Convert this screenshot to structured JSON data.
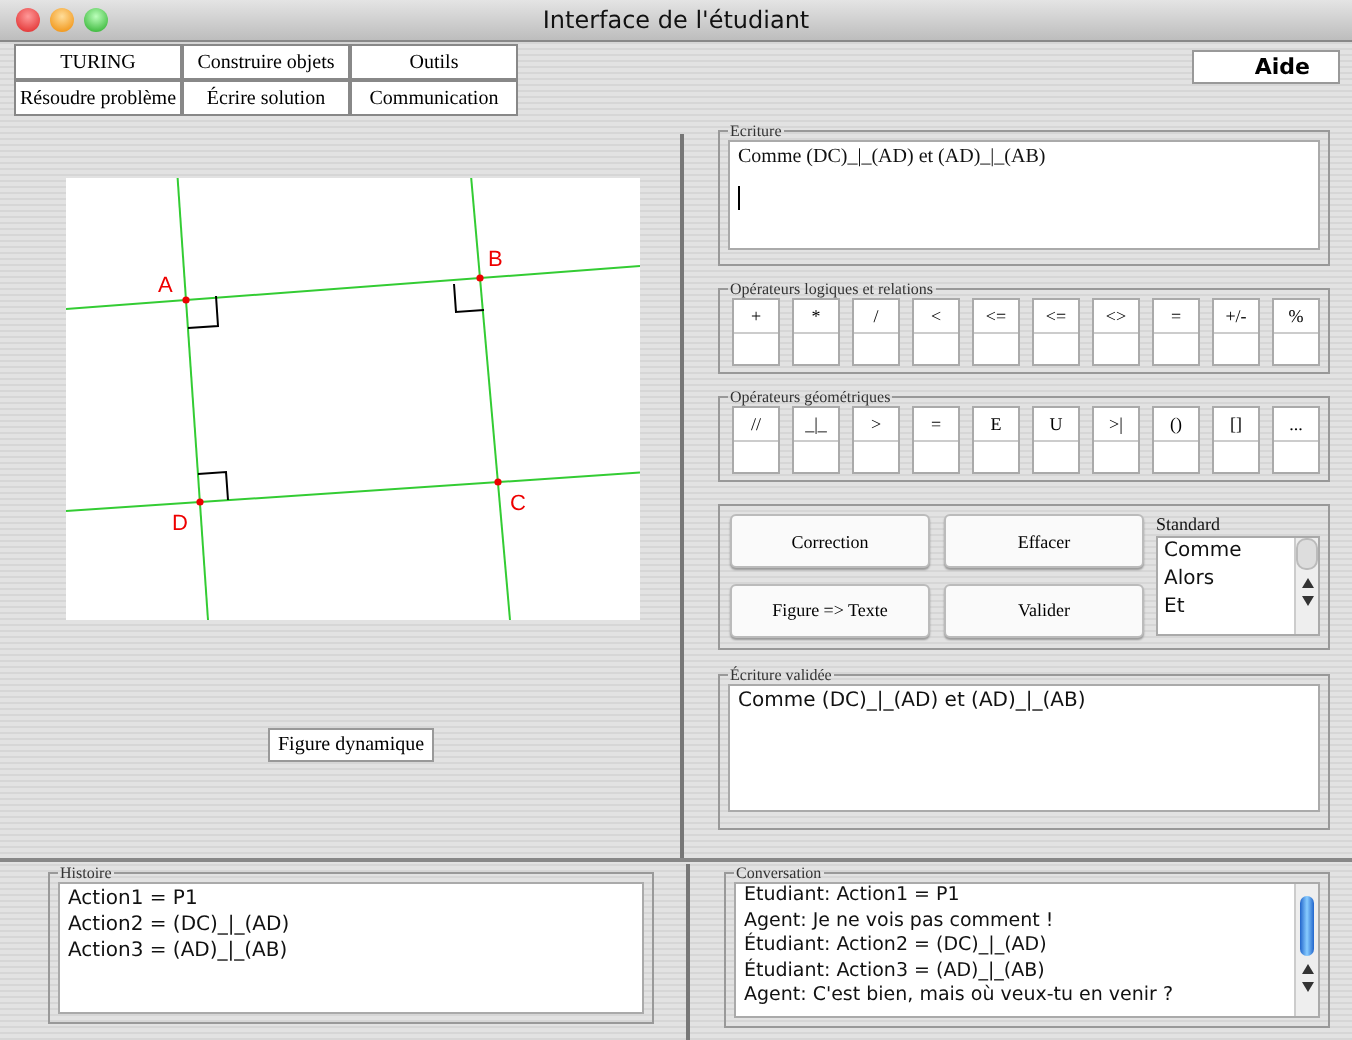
{
  "window": {
    "title": "Interface de l'étudiant"
  },
  "menu": [
    "TURING",
    "Construire objets",
    "Outils",
    "Résoudre problème",
    "Écrire solution",
    "Communication"
  ],
  "help_button": "Aide",
  "figure": {
    "point_labels": [
      "A",
      "B",
      "C",
      "D"
    ]
  },
  "dynamic_figure_button": "Figure dynamique",
  "writing": {
    "legend": "Ecriture",
    "text": "Comme (DC)_|_(AD) et  (AD)_|_(AB)"
  },
  "logical_operators": {
    "legend": "Opérateurs logiques et relations",
    "keys": [
      "+",
      "*",
      "/",
      "<",
      "<=",
      "<=",
      "<>",
      "=",
      "+/-",
      "%"
    ]
  },
  "geometric_operators": {
    "legend": "Opérateurs géométriques",
    "keys": [
      "//",
      "_|_",
      ">",
      "=",
      "E",
      "U",
      ">|",
      "()",
      "[]",
      "..."
    ]
  },
  "actions": [
    "Correction",
    "Effacer",
    "Figure => Texte",
    "Valider"
  ],
  "standard": {
    "legend": "Standard",
    "items": [
      "Comme",
      "Alors",
      "Et"
    ]
  },
  "validated": {
    "legend": "Écriture validée",
    "text": "Comme (DC)_|_(AD) et (AD)_|_(AB)"
  },
  "history": {
    "legend": "Histoire",
    "lines": [
      "Action1 = P1",
      "Action2 = (DC)_|_(AD)",
      "Action3 = (AD)_|_(AB)"
    ]
  },
  "conversation": {
    "legend": "Conversation",
    "lines": [
      "Etudiant: Action1 = P1",
      "Agent: Je ne vois pas comment !",
      "Étudiant: Action2 = (DC)_|_(AD)",
      "Étudiant: Action3 = (AD)_|_(AB)",
      "Agent: C'est bien, mais où veux-tu en venir ?"
    ]
  }
}
